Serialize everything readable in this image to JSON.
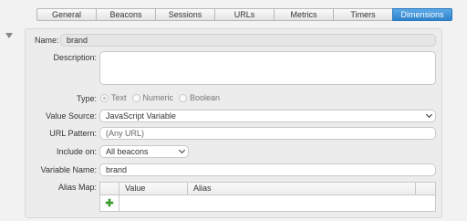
{
  "tabs": [
    {
      "label": "General",
      "active": false
    },
    {
      "label": "Beacons",
      "active": false
    },
    {
      "label": "Sessions",
      "active": false
    },
    {
      "label": "URLs",
      "active": false
    },
    {
      "label": "Metrics",
      "active": false
    },
    {
      "label": "Timers",
      "active": false
    },
    {
      "label": "Dimensions",
      "active": true
    }
  ],
  "form": {
    "name_label": "Name:",
    "name_value": "brand",
    "description_label": "Description:",
    "description_value": "",
    "type_label": "Type:",
    "type_options": [
      "Text",
      "Numeric",
      "Boolean"
    ],
    "type_selected": "Text",
    "value_source_label": "Value Source:",
    "value_source_value": "JavaScript Variable",
    "url_pattern_label": "URL Pattern:",
    "url_pattern_placeholder": "(Any URL)",
    "include_on_label": "Include on:",
    "include_on_value": "All beacons",
    "variable_name_label": "Variable Name:",
    "variable_name_value": "brand",
    "alias_map_label": "Alias Map:",
    "alias_columns": [
      "Value",
      "Alias"
    ],
    "add_icon": "plus-icon"
  },
  "colors": {
    "active_tab": "#3a8fd6",
    "add_icon": "#3a9a2e"
  }
}
